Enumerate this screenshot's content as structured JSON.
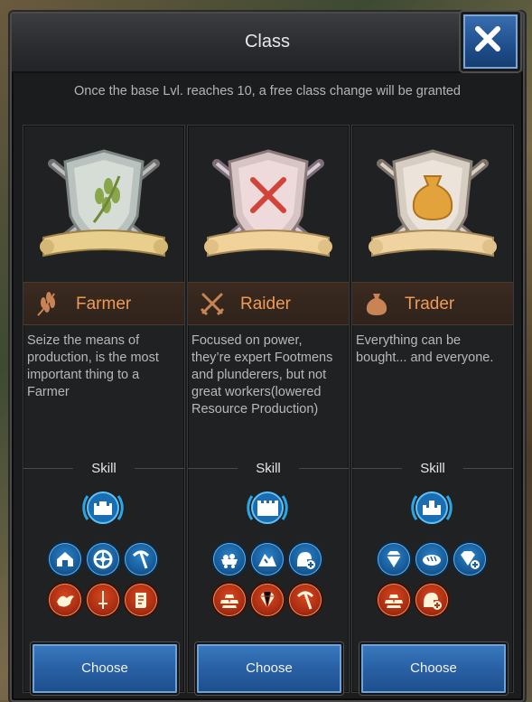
{
  "dialog": {
    "title": "Class",
    "notice": "Once the base Lvl. reaches 10, a free class change will be granted"
  },
  "accent_color": "#ef9a55",
  "classes": [
    {
      "name": "Farmer",
      "icon": "wheat-icon",
      "description": "Seize the means of production, is the most important thing to a Farmer",
      "skill_label": "Skill",
      "button": "Choose",
      "main_skill": "castle-icon",
      "blue_skills": [
        "house-icon",
        "wheel-icon",
        "pickaxe-icon"
      ],
      "red_skills": [
        "bird-icon",
        "sword-icon",
        "scroll-icon"
      ]
    },
    {
      "name": "Raider",
      "icon": "crossed-swords-icon",
      "description": "Focused on power, they’re expert Footmens and plunderers, but not great workers(lowered Resource Production)",
      "skill_label": "Skill",
      "button": "Choose",
      "main_skill": "castle-icon",
      "blue_skills": [
        "mine-cart-icon",
        "ore-icon",
        "ore-boost-icon"
      ],
      "red_skills": [
        "gold-bars-icon",
        "gem-icon",
        "pickaxe-icon"
      ]
    },
    {
      "name": "Trader",
      "icon": "money-bag-icon",
      "description": "Everything can be bought... and everyone.",
      "skill_label": "Skill",
      "button": "Choose",
      "main_skill": "castle-icon",
      "blue_skills": [
        "diamond-icon",
        "bread-icon",
        "diamond-plus-icon"
      ],
      "red_skills": [
        "gold-bars-icon",
        "ore-plus-icon"
      ]
    }
  ]
}
